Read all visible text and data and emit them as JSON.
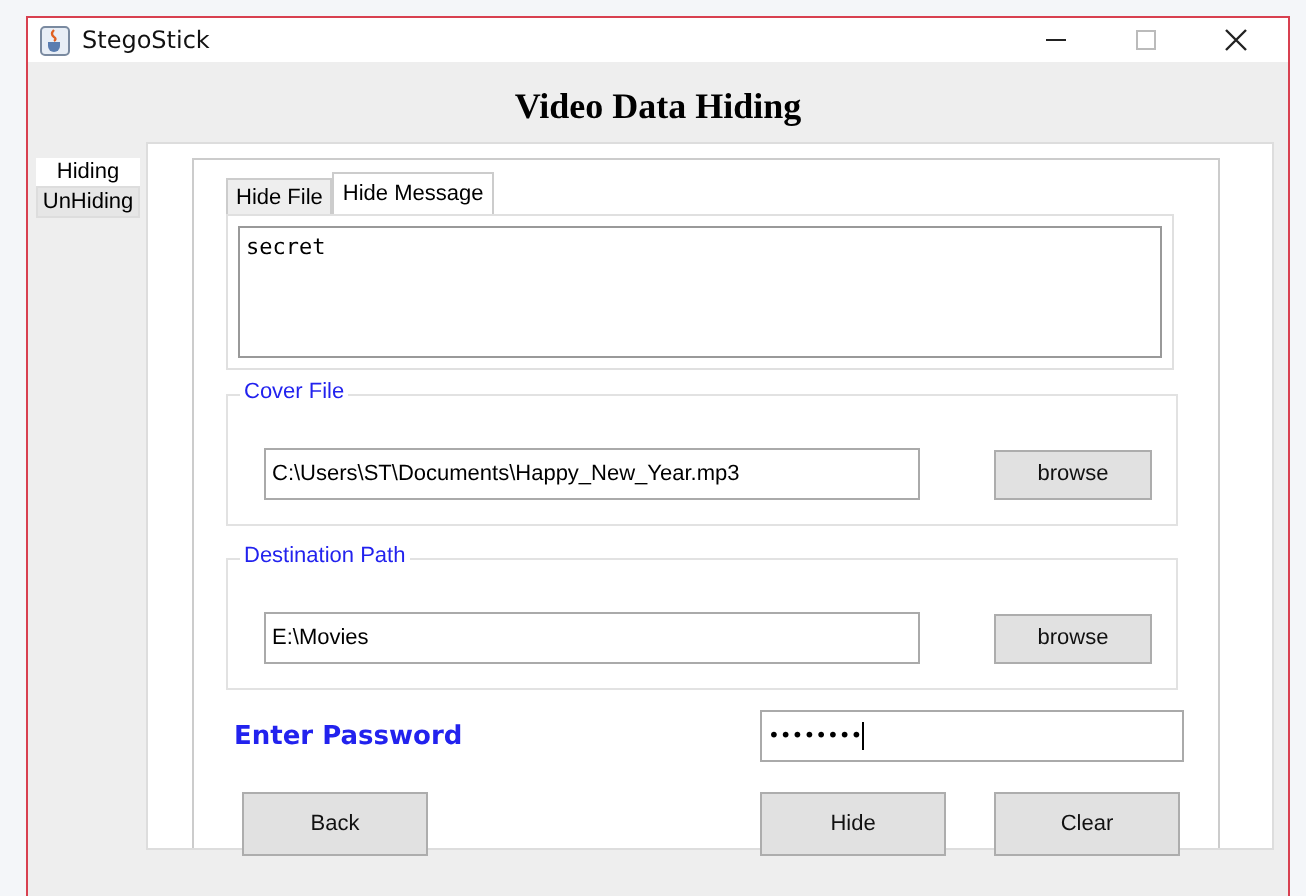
{
  "window": {
    "title": "StegoStick"
  },
  "heading": "Video Data Hiding",
  "side_tabs": [
    {
      "label": "Hiding",
      "selected": true
    },
    {
      "label": "UnHiding",
      "selected": false
    }
  ],
  "tabs": [
    {
      "label": "Hide File",
      "selected": false
    },
    {
      "label": "Hide Message",
      "selected": true
    }
  ],
  "message": "secret",
  "groups": [
    {
      "title": "Cover File",
      "path": "C:\\Users\\ST\\Documents\\Happy_New_Year.mp3",
      "button": "browse"
    },
    {
      "title": "Destination Path",
      "path": "E:\\Movies",
      "button": "browse"
    }
  ],
  "password": {
    "label": "Enter Password",
    "value": "••••••••"
  },
  "buttons": [
    "Back",
    "Hide",
    "Clear"
  ]
}
